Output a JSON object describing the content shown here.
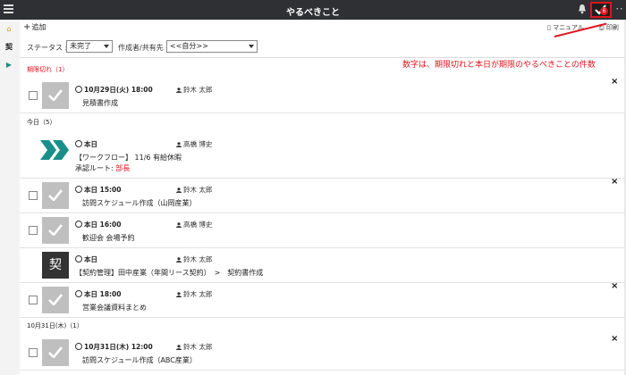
{
  "header": {
    "title": "やるべきこと",
    "todo_count": "6",
    "more": "･･"
  },
  "leftnav": {
    "items": [
      "⌂",
      "契",
      "▶"
    ]
  },
  "toolbar": {
    "add": "追加",
    "add_prefix": "+",
    "manual": "マニュアル",
    "print": "印刷"
  },
  "filters": {
    "status_label": "ステータス :",
    "status_value": "未完了",
    "creator_label": "作成者/共有先 :",
    "creator_value": "<<自分>>"
  },
  "annotation": "数字は、期限切れと本日が期限のやるべきことの件数",
  "sections": {
    "overdue": "期限切れ（1）",
    "today": "今日（5）",
    "oct31": "10月31日(木)（1）"
  },
  "items": [
    {
      "when": "10月29日(火) 18:00",
      "person": "鈴木 太郎",
      "title": "見積書作成"
    },
    {
      "when": "本日",
      "person": "高橋 博史",
      "title": "【ワークフロー】 11/6 有給休暇",
      "route_label": "承認ルート: ",
      "route_value": "部長"
    },
    {
      "when": "本日 15:00",
      "person": "鈴木 太郎",
      "title": "訪問スケジュール作成（山岡産業）"
    },
    {
      "when": "本日 16:00",
      "person": "高橋 博史",
      "title": "歓迎会 会場予約"
    },
    {
      "when": "本日",
      "person": "鈴木 太郎",
      "title": "【契約管理】田中産業（年間リース契約）　>　契約書作成",
      "badge": "契"
    },
    {
      "when": "本日 18:00",
      "person": "鈴木 太郎",
      "title": "営業会議資料まとめ"
    },
    {
      "when": "10月31日(木) 12:00",
      "person": "鈴木 太郎",
      "title": "訪問スケジュール作成（ABC産業）"
    }
  ],
  "colors": {
    "accent": "#e0141e",
    "header_bg": "#2f3033",
    "workflow_green": "#1a8f8a"
  }
}
